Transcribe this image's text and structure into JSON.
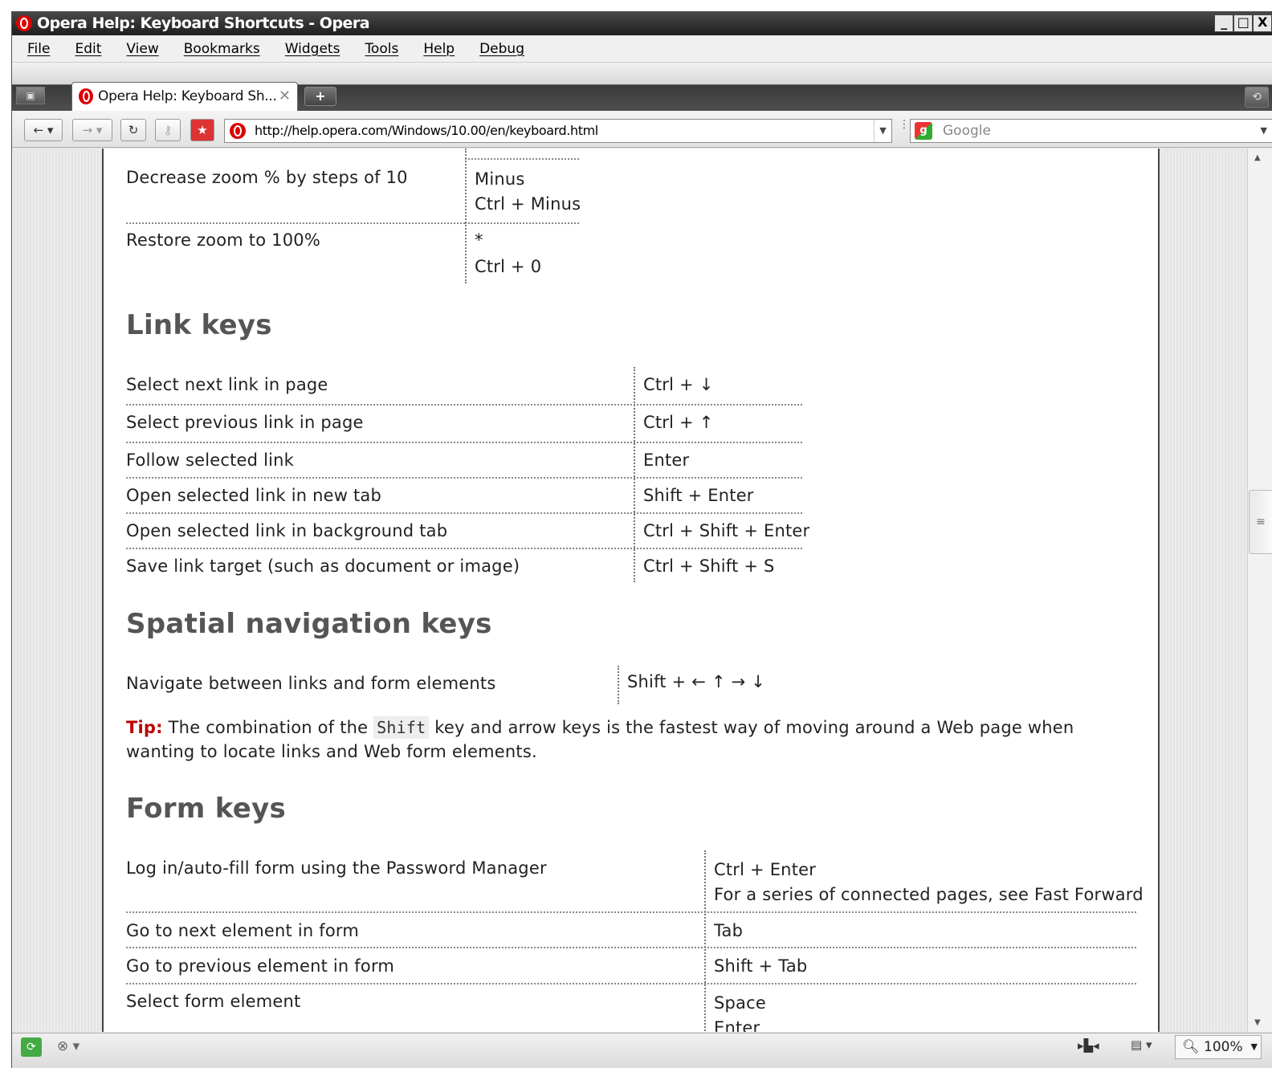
{
  "window": {
    "title": "Opera Help: Keyboard Shortcuts - Opera",
    "controls": [
      "_",
      "□",
      "X"
    ]
  },
  "menu": [
    "File",
    "Edit",
    "View",
    "Bookmarks",
    "Widgets",
    "Tools",
    "Help",
    "Debug"
  ],
  "tab": {
    "label": "Opera Help: Keyboard Sh...",
    "close": "✕",
    "new": "+"
  },
  "address": {
    "url": "http://help.opera.com/Windows/10.00/en/keyboard.html"
  },
  "search": {
    "placeholder": "Google"
  },
  "zoom_section": [
    {
      "action": "Decrease zoom % by steps of 10",
      "keys": [
        "Minus",
        "Ctrl + Minus"
      ]
    },
    {
      "action": "Restore zoom to 100%",
      "keys": [
        "*",
        "Ctrl + 0"
      ]
    }
  ],
  "link_keys": {
    "heading": "Link keys",
    "rows": [
      {
        "action": "Select next link in page",
        "keys": "Ctrl + ↓"
      },
      {
        "action": "Select previous link in page",
        "keys": "Ctrl + ↑"
      },
      {
        "action": "Follow selected link",
        "keys": "Enter"
      },
      {
        "action": "Open selected link in new tab",
        "keys": "Shift + Enter"
      },
      {
        "action": "Open selected link in background tab",
        "keys": "Ctrl + Shift + Enter"
      },
      {
        "action": "Save link target (such as document or image)",
        "keys": "Ctrl + Shift + S"
      }
    ]
  },
  "spatial_keys": {
    "heading": "Spatial navigation keys",
    "rows": [
      {
        "action": "Navigate between links and form elements",
        "keys": "Shift + ← ↑ → ↓"
      }
    ]
  },
  "tip": {
    "label": "Tip:",
    "before": "The combination of the",
    "code": "Shift",
    "after": "key and arrow keys is the fastest way of moving around a Web page when wanting to locate links and Web form elements."
  },
  "form_keys": {
    "heading": "Form keys",
    "rows": [
      {
        "action": "Log in/auto-fill form using the Password Manager",
        "keys": [
          "Ctrl + Enter",
          "For a series of connected pages, see Fast Forward"
        ]
      },
      {
        "action": "Go to next element in form",
        "keys": [
          "Tab"
        ]
      },
      {
        "action": "Go to previous element in form",
        "keys": [
          "Shift + Tab"
        ]
      },
      {
        "action": "Select form element",
        "keys": [
          "Space",
          "Enter"
        ]
      }
    ]
  },
  "status": {
    "zoom": "100%"
  }
}
